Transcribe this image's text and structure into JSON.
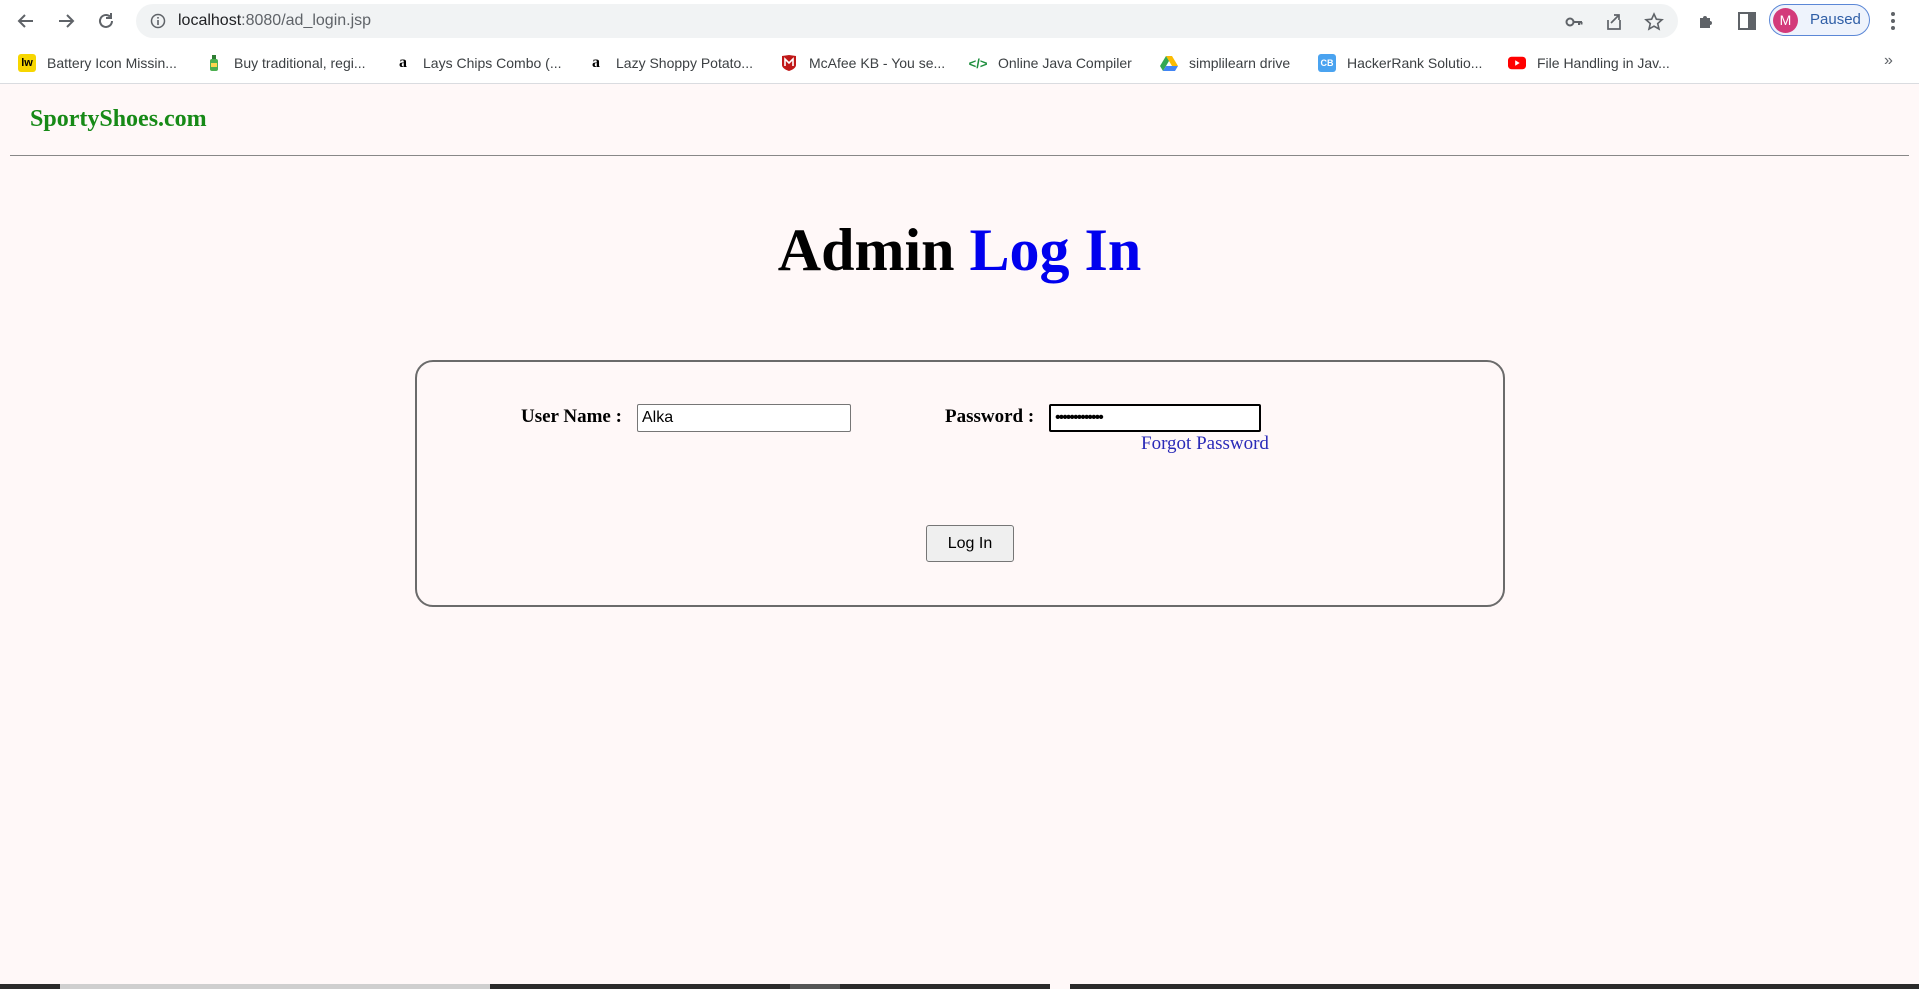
{
  "browser": {
    "url_host": "localhost",
    "url_path": ":8080/ad_login.jsp",
    "profile_initial": "M",
    "profile_status": "Paused",
    "more_bookmarks": "»"
  },
  "bookmarks": [
    {
      "label": "Battery Icon Missin...",
      "icon": "lw-icon",
      "color": "#f7d600"
    },
    {
      "label": "Buy traditional, regi...",
      "icon": "bottle-icon",
      "color": "#2e7d32"
    },
    {
      "label": "Lays Chips Combo (...",
      "icon": "amazon-icon",
      "color": "#000000"
    },
    {
      "label": "Lazy Shoppy Potato...",
      "icon": "amazon-icon",
      "color": "#000000"
    },
    {
      "label": "McAfee KB - You se...",
      "icon": "mcafee-icon",
      "color": "#c01818"
    },
    {
      "label": "Online Java Compiler",
      "icon": "code-icon",
      "color": "#1e8e3e"
    },
    {
      "label": "simplilearn drive",
      "icon": "google-drive-icon",
      "color": "#1a73e8"
    },
    {
      "label": "HackerRank Solutio...",
      "icon": "cb-icon",
      "color": "#4aa3f0"
    },
    {
      "label": "File Handling in Jav...",
      "icon": "youtube-icon",
      "color": "#ff0000"
    }
  ],
  "page": {
    "site_name": "SportyShoes.com",
    "title_part1": "Admin",
    "title_part2": "Log In",
    "form": {
      "username_label": "User Name :",
      "username_value": "Alka",
      "password_label": "Password :",
      "password_value": "•••••••••••••",
      "forgot_label": "Forgot Password",
      "submit_label": "Log In"
    }
  },
  "colors": {
    "background": "#fff8f8",
    "site_name": "#178a17",
    "title_accent": "#0000ee",
    "link": "#2a2ab8"
  }
}
